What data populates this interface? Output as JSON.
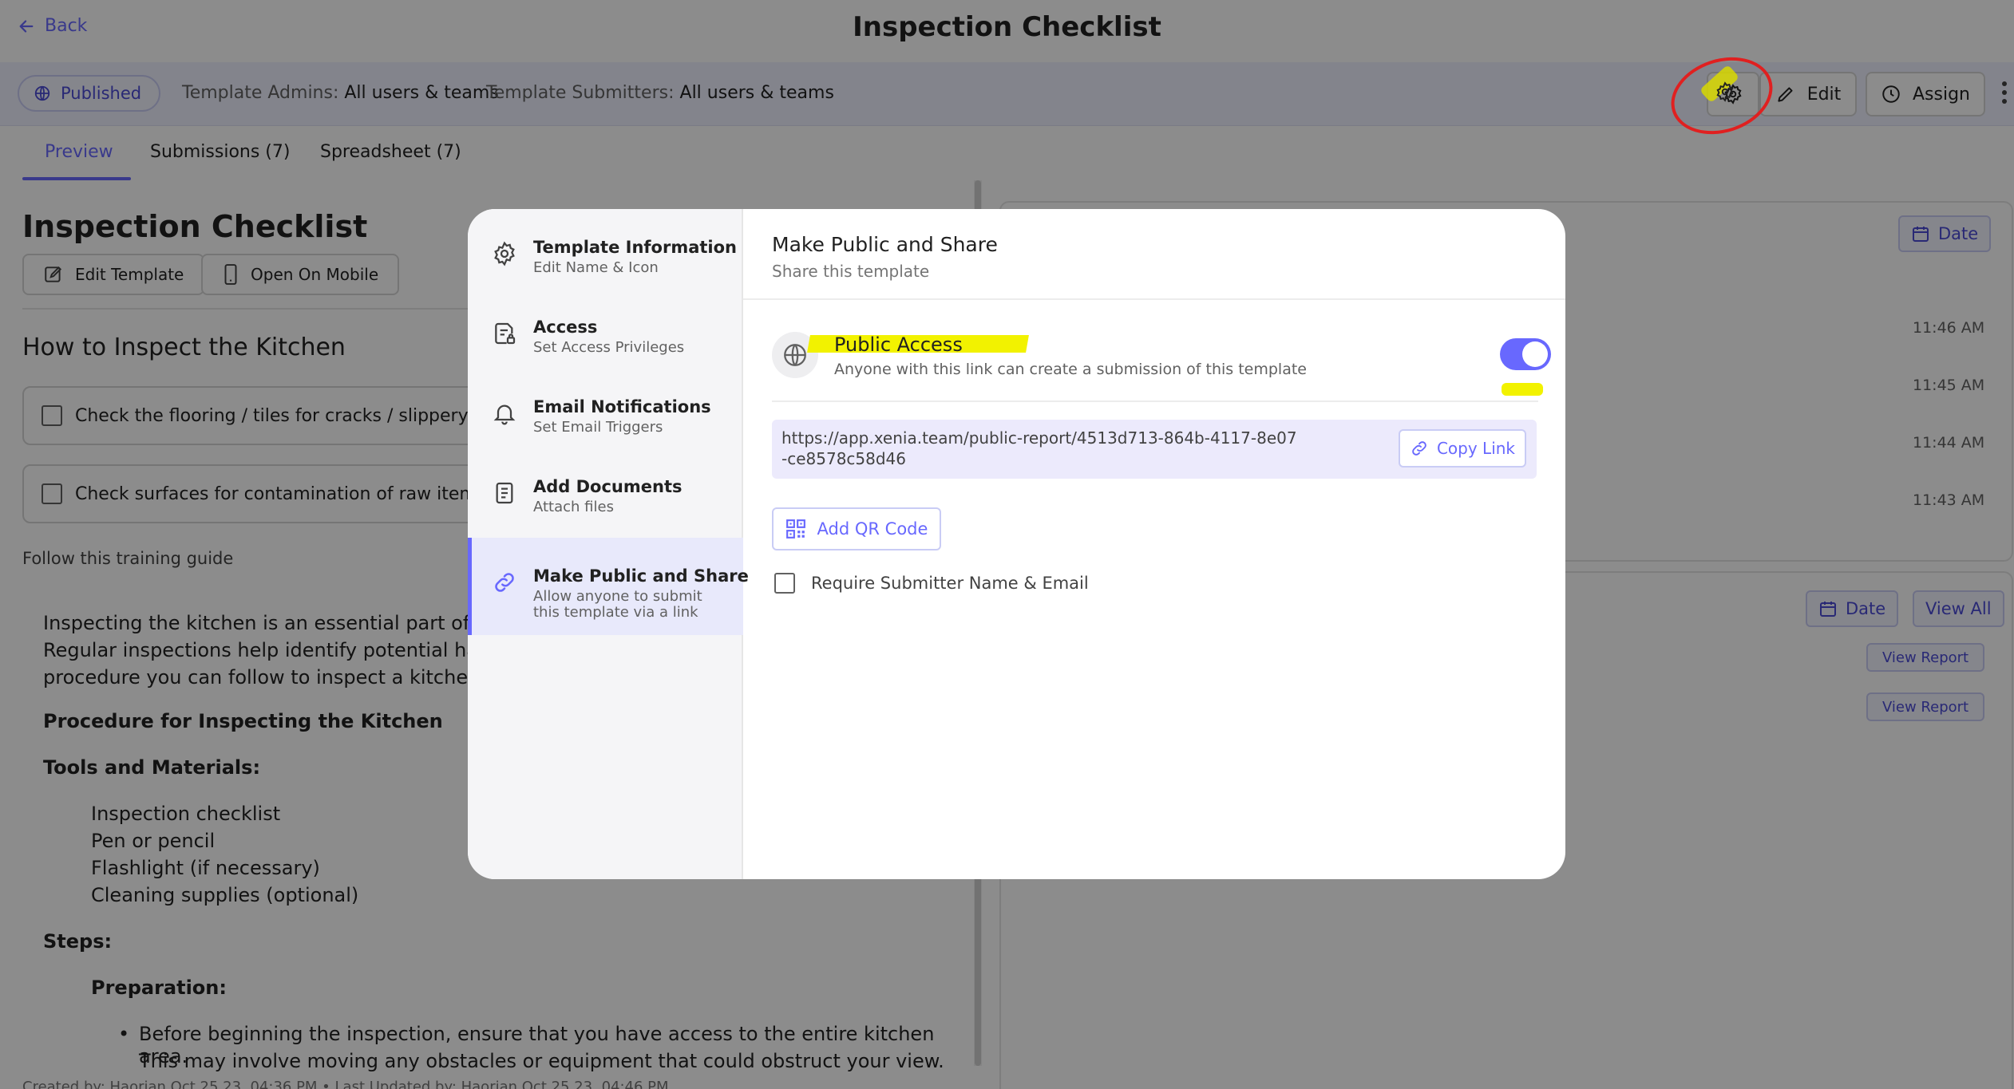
{
  "header": {
    "back_label": "Back",
    "title": "Inspection Checklist"
  },
  "statusbar": {
    "status": "Published",
    "admins_label": "Template Admins:",
    "admins_value": "All users & teams",
    "submitters_label": "Template Submitters:",
    "submitters_value": "All users & teams",
    "edit_label": "Edit",
    "assign_label": "Assign"
  },
  "tabs": [
    {
      "label": "Preview",
      "active": true
    },
    {
      "label": "Submissions (7)",
      "active": false
    },
    {
      "label": "Spreadsheet (7)",
      "active": false
    }
  ],
  "preview": {
    "title": "Inspection Checklist",
    "edit_template": "Edit Template",
    "open_on_mobile": "Open On Mobile",
    "section_title": "How to Inspect the Kitchen",
    "checks": [
      "Check the flooring / tiles for cracks / slippery areas",
      "Check surfaces for contamination of raw items and"
    ],
    "follow": "Follow this training guide",
    "intro": [
      "Inspecting the kitchen is an essential part of maint",
      "Regular inspections help identify potential hazards",
      "procedure you can follow to inspect a kitchen:"
    ],
    "procedure_heading": "Procedure for Inspecting the Kitchen",
    "tools_heading": "Tools and Materials:",
    "tools": [
      "Inspection checklist",
      "Pen or pencil",
      "Flashlight (if necessary)",
      "Cleaning supplies (optional)"
    ],
    "steps_heading": "Steps:",
    "prep_heading": "Preparation:",
    "bullet_line1": "Before beginning the inspection, ensure that you have access to the entire kitchen area.",
    "bullet_line2": "This may involve moving any obstacles or equipment that could obstruct your view.",
    "footer": "Created by: Haorian Oct 25 23, 04:36 PM  •  Last Updated by: Haorian Oct 25 23, 04:46 PM"
  },
  "right_panel": {
    "date_label": "Date",
    "view_all": "View All",
    "times": [
      "11:46 AM",
      "11:45 AM",
      "11:44 AM",
      "11:43 AM"
    ],
    "view_report": "View Report"
  },
  "modal": {
    "nav": [
      {
        "title": "Template Information",
        "sub": "Edit Name & Icon",
        "icon": "gear-icon"
      },
      {
        "title": "Access",
        "sub": "Set Access Privileges",
        "icon": "access-doc-icon"
      },
      {
        "title": "Email Notifications",
        "sub": "Set Email Triggers",
        "icon": "bell-icon"
      },
      {
        "title": "Add Documents",
        "sub": "Attach files",
        "icon": "documents-icon"
      },
      {
        "title": "Make Public and Share",
        "sub": "Allow anyone to submit this template via a link",
        "icon": "link-icon",
        "active": true
      }
    ],
    "title": "Make Public and Share",
    "subtitle": "Share this template",
    "public_access_title": "Public Access",
    "public_access_sub": "Anyone with this link can create a submission of this template",
    "public_access_enabled": true,
    "url": "https://app.xenia.team/public-report/4513d713-864b-4117-8e07-ce8578c58d46",
    "copy_link": "Copy Link",
    "add_qr": "Add QR Code",
    "require_label": "Require Submitter Name & Email",
    "require_checked": false
  },
  "colors": {
    "accent": "#6868fe",
    "highlight": "#f2f200",
    "annotation": "#e02020"
  }
}
